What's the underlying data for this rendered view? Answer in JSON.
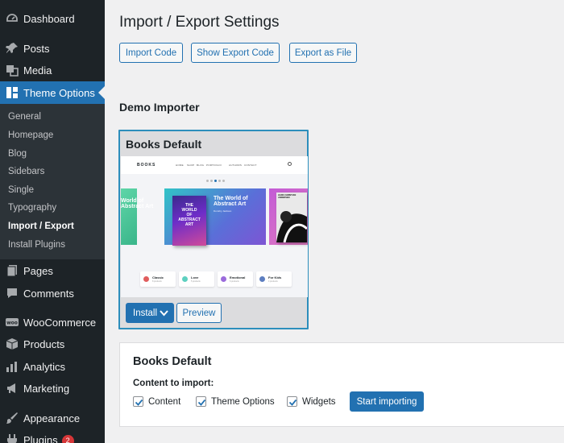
{
  "sidebar": {
    "items": [
      {
        "id": "dashboard",
        "label": "Dashboard",
        "icon": "dashboard-icon"
      },
      {
        "id": "posts",
        "label": "Posts",
        "icon": "pin-icon"
      },
      {
        "id": "media",
        "label": "Media",
        "icon": "media-icon"
      },
      {
        "id": "theme-options",
        "label": "Theme Options",
        "icon": "layout-icon"
      },
      {
        "id": "pages",
        "label": "Pages",
        "icon": "pages-icon"
      },
      {
        "id": "comments",
        "label": "Comments",
        "icon": "comment-icon"
      },
      {
        "id": "woocommerce",
        "label": "WooCommerce",
        "icon": "woo-icon"
      },
      {
        "id": "products",
        "label": "Products",
        "icon": "box-icon"
      },
      {
        "id": "analytics",
        "label": "Analytics",
        "icon": "bar-chart-icon"
      },
      {
        "id": "marketing",
        "label": "Marketing",
        "icon": "megaphone-icon"
      },
      {
        "id": "appearance",
        "label": "Appearance",
        "icon": "brush-icon"
      },
      {
        "id": "plugins",
        "label": "Plugins",
        "icon": "plug-icon",
        "badge": "2"
      }
    ],
    "submenu": [
      "General",
      "Homepage",
      "Blog",
      "Sidebars",
      "Single",
      "Typography",
      "Import / Export",
      "Install Plugins"
    ]
  },
  "main": {
    "title": "Import / Export Settings",
    "buttons": {
      "import_code": "Import Code",
      "show_export_code": "Show Export Code",
      "export_file": "Export as File"
    },
    "section_title": "Demo Importer"
  },
  "demo": {
    "title": "Books Default",
    "install_label": "Install",
    "preview_label": "Preview",
    "site_preview": {
      "logo": "BOOKS",
      "nav": [
        "HOME",
        "SHOP",
        "BLOG",
        "PORTFOLIO",
        "AUTHORS",
        "CONTACT"
      ],
      "slide_left_title": "World of\nAbstract Art",
      "slide_title": "The World of\nAbstract Art",
      "slide_sub": "Dorothy Jackson",
      "book_cover": "THE\nWORLD\nOF\nABSTRACT\nART",
      "slide_right_cover": "HANS CHRISTIAN\nANDERSEN",
      "categories": [
        {
          "label": "Classic",
          "sub": "8 products",
          "color": "#e05d5d"
        },
        {
          "label": "Love",
          "sub": "5 products",
          "color": "#5dd0c0"
        },
        {
          "label": "Emotional",
          "sub": "6 products",
          "color": "#9b6bdb"
        },
        {
          "label": "For Kids",
          "sub": "4 products",
          "color": "#5d7ec0"
        }
      ]
    }
  },
  "import": {
    "title": "Books Default",
    "content_label": "Content to import:",
    "options": [
      {
        "label": "Content",
        "checked": true
      },
      {
        "label": "Theme Options",
        "checked": true
      },
      {
        "label": "Widgets",
        "checked": true
      }
    ],
    "start_label": "Start importing"
  },
  "colors": {
    "accent": "#2271b1",
    "sidebar_bg": "#1d2327",
    "badge": "#d63638"
  }
}
